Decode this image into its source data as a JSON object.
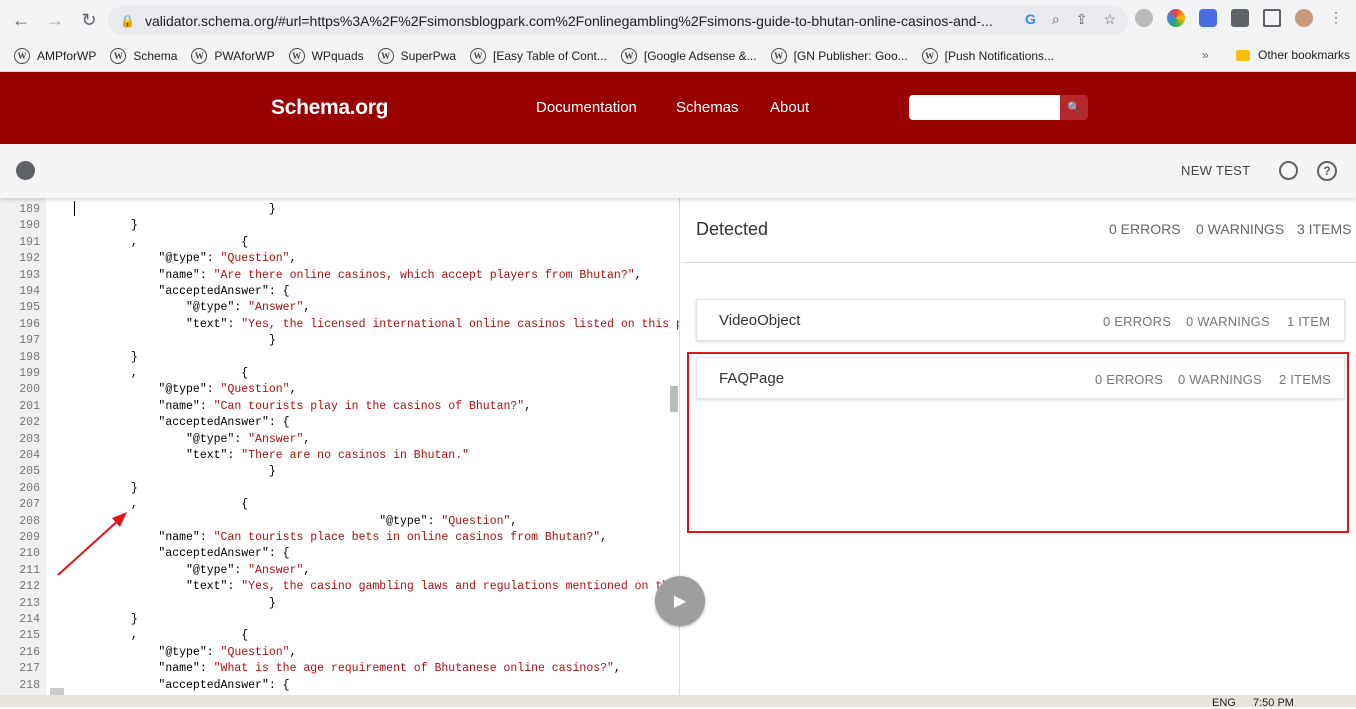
{
  "browser": {
    "url": "validator.schema.org/#url=https%3A%2F%2Fsimonsblogpark.com%2Fonlinegambling%2Fsimons-guide-to-bhutan-online-casinos-and-...",
    "bookmarks": [
      "AMPforWP",
      "Schema",
      "PWAforWP",
      "WPquads",
      "SuperPwa",
      "[Easy Table of Cont...",
      "[Google Adsense &...",
      "[GN Publisher: Goo...",
      "[Push Notifications..."
    ],
    "more": "»",
    "other_bookmarks": "Other bookmarks"
  },
  "header": {
    "logo": "Schema.org",
    "nav": [
      "Documentation",
      "Schemas",
      "About"
    ]
  },
  "toolbar": {
    "new_test": "NEW TEST",
    "help": "?"
  },
  "code": {
    "lines": [
      {
        "n": "189",
        "t": "                                }"
      },
      {
        "n": "190",
        "t": "            }"
      },
      {
        "n": "191",
        "t": "            ,               {"
      },
      {
        "n": "192",
        "t": "                \"@type\": \"Question\","
      },
      {
        "n": "193",
        "t": "                \"name\": \"Are there online casinos, which accept players from Bhutan?\","
      },
      {
        "n": "194",
        "t": "                \"acceptedAnswer\": {"
      },
      {
        "n": "195",
        "t": "                    \"@type\": \"Answer\","
      },
      {
        "n": "196",
        "t": "                    \"text\": \"Yes, the licensed international online casinos listed on this page ac"
      },
      {
        "n": "197",
        "t": "                                }"
      },
      {
        "n": "198",
        "t": "            }"
      },
      {
        "n": "199",
        "t": "            ,               {"
      },
      {
        "n": "200",
        "t": "                \"@type\": \"Question\","
      },
      {
        "n": "201",
        "t": "                \"name\": \"Can tourists play in the casinos of Bhutan?\","
      },
      {
        "n": "202",
        "t": "                \"acceptedAnswer\": {"
      },
      {
        "n": "203",
        "t": "                    \"@type\": \"Answer\","
      },
      {
        "n": "204",
        "t": "                    \"text\": \"There are no casinos in Bhutan.\""
      },
      {
        "n": "205",
        "t": "                                }"
      },
      {
        "n": "206",
        "t": "            }"
      },
      {
        "n": "207",
        "t": "            ,               {"
      },
      {
        "n": "208",
        "t": "                                                \"@type\": \"Question\","
      },
      {
        "n": "209",
        "t": "                \"name\": \"Can tourists place bets in online casinos from Bhutan?\","
      },
      {
        "n": "210",
        "t": "                \"acceptedAnswer\": {"
      },
      {
        "n": "211",
        "t": "                    \"@type\": \"Answer\","
      },
      {
        "n": "212",
        "t": "                    \"text\": \"Yes, the casino gambling laws and regulations mentioned on this pa"
      },
      {
        "n": "213",
        "t": "                                }"
      },
      {
        "n": "214",
        "t": "            }"
      },
      {
        "n": "215",
        "t": "            ,               {"
      },
      {
        "n": "216",
        "t": "                \"@type\": \"Question\","
      },
      {
        "n": "217",
        "t": "                \"name\": \"What is the age requirement of Bhutanese online casinos?\","
      },
      {
        "n": "218",
        "t": "                \"acceptedAnswer\": {"
      }
    ]
  },
  "results": {
    "title": "Detected",
    "errors": "0 ERRORS",
    "warnings": "0 WARNINGS",
    "items": "3 ITEMS",
    "cards": [
      {
        "name": "VideoObject",
        "errors": "0 ERRORS",
        "warnings": "0 WARNINGS",
        "items": "1 ITEM"
      },
      {
        "name": "FAQPage",
        "errors": "0 ERRORS",
        "warnings": "0 WARNINGS",
        "items": "2 ITEMS"
      }
    ]
  },
  "taskbar": {
    "lang": "ENG",
    "time": "7:50 PM"
  }
}
